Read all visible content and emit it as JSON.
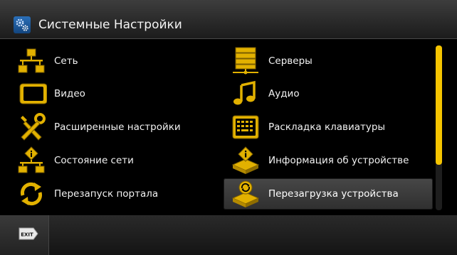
{
  "header": {
    "title": "Системные Настройки",
    "icon": "gears-icon"
  },
  "menu": {
    "left": [
      {
        "label": "Сеть",
        "icon": "network-icon"
      },
      {
        "label": "Видео",
        "icon": "monitor-icon"
      },
      {
        "label": "Расширенные настройки",
        "icon": "tools-icon"
      },
      {
        "label": "Состояние сети",
        "icon": "network-info-icon"
      },
      {
        "label": "Перезапуск портала",
        "icon": "refresh-icon"
      }
    ],
    "right": [
      {
        "label": "Серверы",
        "icon": "server-icon"
      },
      {
        "label": "Аудио",
        "icon": "music-note-icon"
      },
      {
        "label": "Раскладка клавиатуры",
        "icon": "keyboard-icon"
      },
      {
        "label": "Информация об устройстве",
        "icon": "device-info-icon"
      },
      {
        "label": "Перезагрузка устройства",
        "icon": "device-reboot-icon",
        "selected": true
      }
    ]
  },
  "scroll": {
    "position": 0
  },
  "footer": {
    "exit_key": "EXIT"
  },
  "colors": {
    "accent": "#f5c400",
    "icon_gold": "#e2b100",
    "background": "#000000"
  }
}
